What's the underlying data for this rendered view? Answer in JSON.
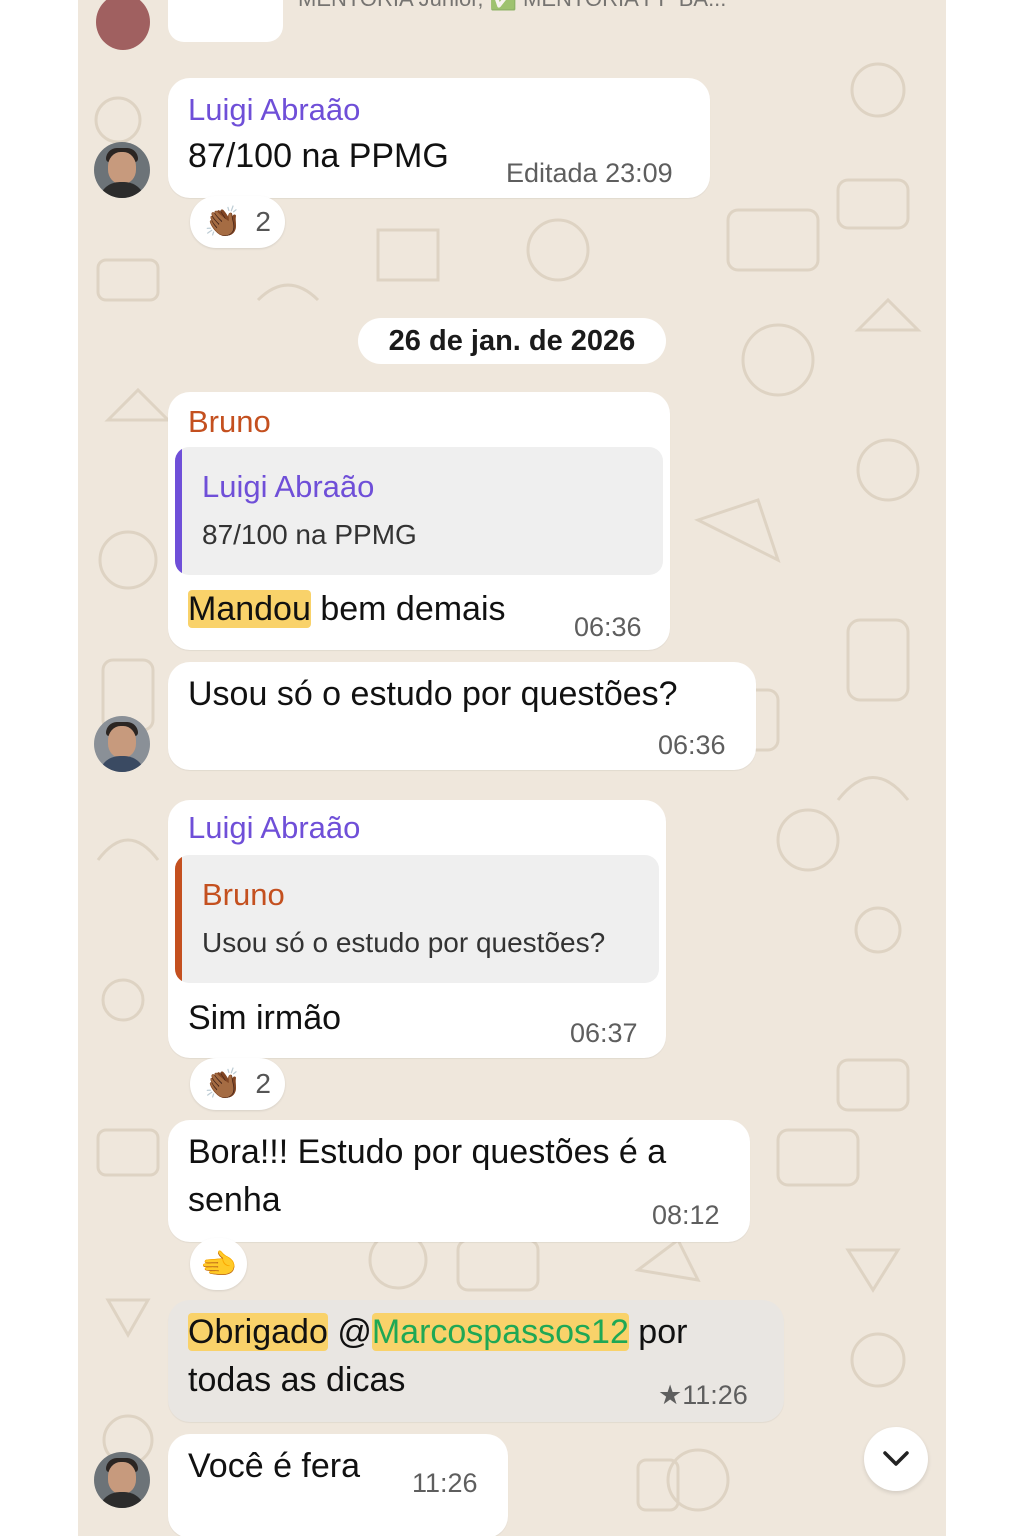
{
  "header": {
    "group_names": "MENTORIA Junior, ✅ MENTORIA PP BA..."
  },
  "date_separator": "26 de jan. de 2026",
  "colors": {
    "chat_background": "#efe7dc",
    "bubble": "#ffffff",
    "highlighted_bubble": "#e9e6e2",
    "name_luigi": "#6f4fd8",
    "name_bruno": "#c4501f",
    "search_highlight": "#f9d26a",
    "mention": "#1fa855"
  },
  "messages": [
    {
      "sender": "Luigi Abraão",
      "text": "87/100 na PPMG",
      "time": "Editada 23:09",
      "reaction": {
        "emoji": "👏🏾",
        "count": "2"
      }
    },
    {
      "sender": "Bruno",
      "quote": {
        "sender": "Luigi Abraão",
        "text": "87/100 na PPMG"
      },
      "text_highlight": "Mandou",
      "text_rest": " bem demais",
      "time": "06:36"
    },
    {
      "text": "Usou só o estudo por questões?",
      "time": "06:36"
    },
    {
      "sender": "Luigi Abraão",
      "quote": {
        "sender": "Bruno",
        "text": "Usou só o estudo por questões?"
      },
      "text": "Sim irmão",
      "time": "06:37",
      "reaction": {
        "emoji": "👏🏾",
        "count": "2"
      }
    },
    {
      "text_line1": "Bora!!! Estudo por questões é a",
      "text_line2": "senha",
      "time": "08:12",
      "reaction": {
        "emoji": "🫲"
      }
    },
    {
      "text_highlight": "Obrigado",
      "at": " @",
      "mention": "Marcospassos12",
      "text_rest": " por",
      "text_line2": "todas as dicas",
      "star": "★",
      "time": "11:26"
    },
    {
      "text": "Você é fera",
      "time": "11:26"
    }
  ],
  "icons": {
    "scroll_down": "chevron-down-icon"
  }
}
